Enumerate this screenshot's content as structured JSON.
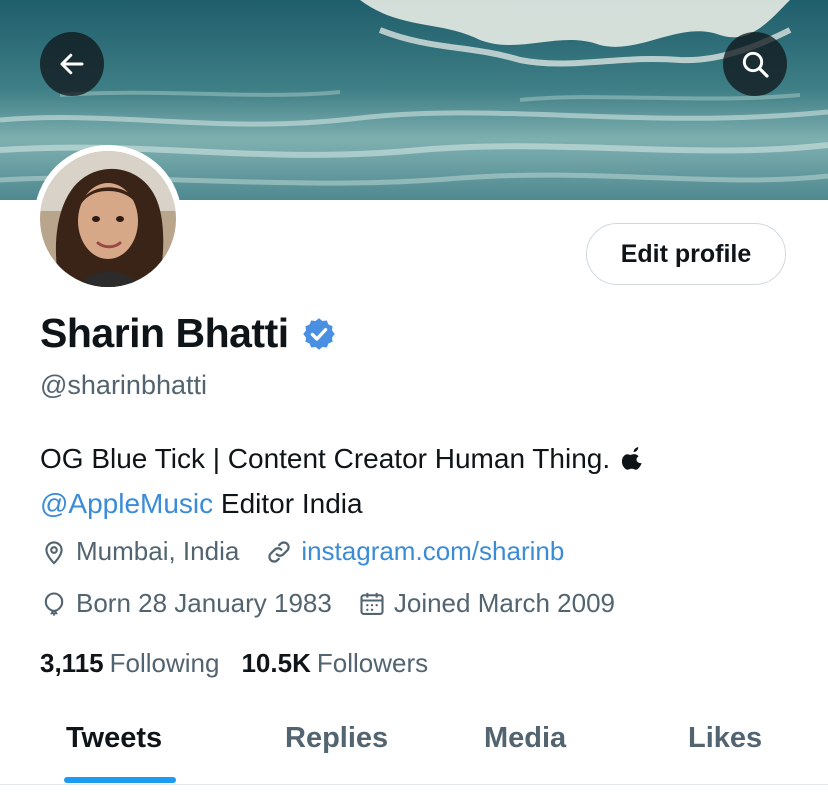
{
  "header": {
    "back_icon": "arrow-left-icon",
    "search_icon": "search-icon"
  },
  "profile": {
    "edit_label": "Edit profile",
    "name": "Sharin Bhatti",
    "verified_icon": "verified-badge-icon",
    "handle": "@sharinbhatti",
    "bio_line1": "OG Blue Tick | Content Creator Human Thing.",
    "bio_apple_icon": "apple-logo-icon",
    "bio_mention": "@AppleMusic",
    "bio_line2_rest": " Editor India",
    "location": "Mumbai, India",
    "website": "instagram.com/sharinb",
    "birthday": "Born 28 January 1983",
    "joined": "Joined March 2009"
  },
  "stats": {
    "following_count": "3,115",
    "following_label": "Following",
    "followers_count": "10.5K",
    "followers_label": "Followers"
  },
  "tabs": [
    {
      "label": "Tweets",
      "active": true
    },
    {
      "label": "Replies",
      "active": false
    },
    {
      "label": "Media",
      "active": false
    },
    {
      "label": "Likes",
      "active": false
    }
  ],
  "colors": {
    "accent": "#1d9bf0",
    "link": "#3b8cd8",
    "secondary_text": "#536471"
  }
}
